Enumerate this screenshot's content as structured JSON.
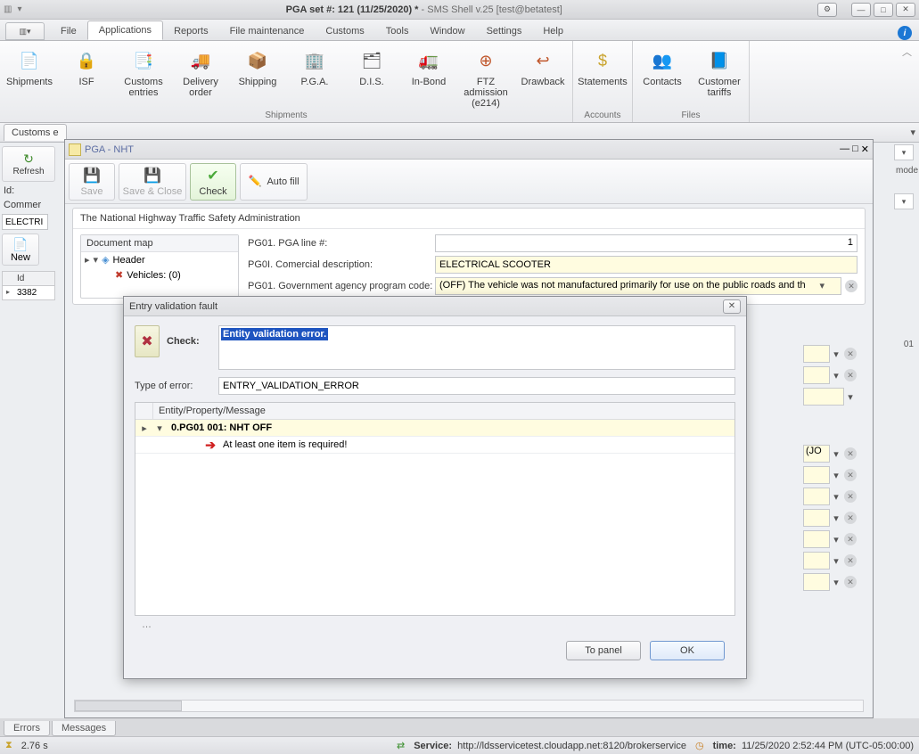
{
  "title": {
    "bold": "PGA set #: 121 (11/25/2020) *",
    "rest": " - SMS Shell v.25 [test@betatest]"
  },
  "menus": {
    "file": "File",
    "applications": "Applications",
    "reports": "Reports",
    "filemaint": "File maintenance",
    "customs": "Customs",
    "tools": "Tools",
    "window": "Window",
    "settings": "Settings",
    "help": "Help"
  },
  "ribbon": {
    "shipments": {
      "label": "Shipments",
      "items": [
        {
          "k": "shipments",
          "label": "Shipments",
          "color": "#2b72c3",
          "glyph": "📄"
        },
        {
          "k": "isf",
          "label": "ISF",
          "color": "#2b72c3",
          "glyph": "🔒"
        },
        {
          "k": "customs",
          "label": "Customs\nentries",
          "color": "#2b72c3",
          "glyph": "📑"
        },
        {
          "k": "delivery",
          "label": "Delivery\norder",
          "color": "#4d8f2e",
          "glyph": "🚚"
        },
        {
          "k": "shipping",
          "label": "Shipping",
          "color": "#b07c2d",
          "glyph": "📦"
        },
        {
          "k": "pga",
          "label": "P.G.A.",
          "color": "#2b72c3",
          "glyph": "🏢"
        },
        {
          "k": "dis",
          "label": "D.I.S.",
          "color": "#555",
          "glyph": "🗂"
        },
        {
          "k": "inbond",
          "label": "In-Bond",
          "color": "#333",
          "glyph": "🚛"
        },
        {
          "k": "ftz",
          "label": "FTZ admission\n(e214)",
          "color": "#c0572c",
          "glyph": "⊕"
        },
        {
          "k": "drawback",
          "label": "Drawback",
          "color": "#c0572c",
          "glyph": "↩"
        }
      ]
    },
    "accounts": {
      "label": "Accounts",
      "items": [
        {
          "k": "statements",
          "label": "Statements",
          "color": "#c9a32d",
          "glyph": "$"
        }
      ]
    },
    "files": {
      "label": "Files",
      "items": [
        {
          "k": "contacts",
          "label": "Contacts",
          "color": "#3a6aa8",
          "glyph": "👥"
        },
        {
          "k": "tariffs",
          "label": "Customer\ntariffs",
          "color": "#3a6aa8",
          "glyph": "📘"
        }
      ]
    }
  },
  "custtab": "Customs e",
  "refresh": "Refresh",
  "idlabel": "Id:",
  "commerlabel": "Commer",
  "commerval": "ELECTRI",
  "newlabel": "New",
  "idcol": "Id",
  "idval": "3382",
  "childwin": {
    "title": "PGA - NHT",
    "toolbar": {
      "save": "Save",
      "saveclose": "Save & Close",
      "check": "Check",
      "autofill": "Auto fill"
    },
    "header": "The National Highway Traffic Safety Administration",
    "docmap": {
      "title": "Document map",
      "header": "Header",
      "vehicles": "Vehicles: (0)"
    },
    "form": {
      "line_label": "PG01. PGA line #:",
      "line_val": "1",
      "desc_label": "PG0I. Comercial description:",
      "desc_val": "ELECTRICAL SCOOTER",
      "code_label": "PG01. Government agency program code:",
      "code_val": "(OFF) The vehicle was not manufactured primarily for use on the public roads and th"
    }
  },
  "rightpartial": {
    "mode": "mode",
    "val01": "01",
    "jo": "(JO"
  },
  "dialog": {
    "title": "Entry validation fault",
    "check_label": "Check:",
    "check_text": "Entity validation error.",
    "type_label": "Type of error:",
    "type_val": "ENTRY_VALIDATION_ERROR",
    "grid_header": "Entity/Property/Message",
    "row_bold": "0.PG01 001: NHT OFF",
    "row_msg": "At least one item is required!",
    "to_panel": "To panel",
    "ok": "OK"
  },
  "bottomtabs": {
    "errors": "Errors",
    "messages": "Messages"
  },
  "status": {
    "time_elapsed": "2.76 s",
    "service_label": "Service:",
    "service_url": "http://ldsservicetest.cloudapp.net:8120/brokerservice",
    "time_label": "time:",
    "time_val": "11/25/2020 2:52:44 PM (UTC-05:00:00)"
  }
}
